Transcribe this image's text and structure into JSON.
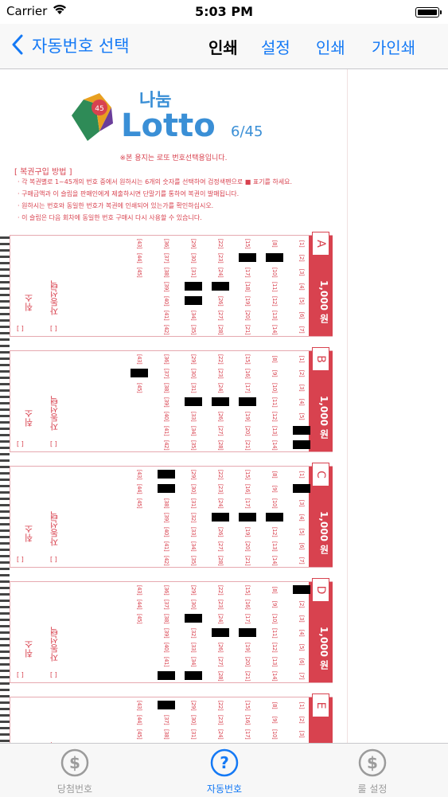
{
  "status_bar": {
    "carrier": "Carrier",
    "time": "5:03 PM"
  },
  "nav": {
    "back_label": "자동번호 선택",
    "title": "인쇄",
    "buttons": [
      "설정",
      "인쇄",
      "가인쇄"
    ]
  },
  "ticket": {
    "logo_brand": "나눔",
    "logo_lotto": "Lotto",
    "logo_game": "6/45",
    "logo_ball": "45",
    "notice": "※본 용지는 로또 번호선택용입니다.",
    "how_to_header": "[ 복권구입 방법 ]",
    "instructions": [
      "· 각 복권별로 1~45개의 번호 중에서 원하시는 6개의 숫자를 선택하여 검정색펜으로 ■ 표기를 하세요.",
      "· 구매금액과 이 슬립을 판매인에게 제출하시면 단말기를 통하여 복권이 발매됩니다.",
      "· 원하시는 번호와 동일한 번호가 복권에 인쇄되어 있는가를 확인하십시오.",
      "· 이 슬립은 다음 회차에 동일한 번호 구매시 다시 사용할 수 있습니다."
    ],
    "price_label": "1,000 원",
    "auto_label": "자동선택",
    "cancel_label": "취소",
    "bracket": "[   ]",
    "games": [
      {
        "letter": "A",
        "marked": [
          9,
          16,
          25,
          32,
          33
        ]
      },
      {
        "letter": "B",
        "marked": [
          6,
          7,
          18,
          25,
          32,
          44
        ]
      },
      {
        "letter": "C",
        "marked": [
          2,
          11,
          18,
          25,
          36,
          37
        ]
      },
      {
        "letter": "D",
        "marked": [
          1,
          18,
          25,
          31,
          35,
          42
        ]
      },
      {
        "letter": "E",
        "marked": [
          36
        ]
      }
    ]
  },
  "tabbar": {
    "items": [
      {
        "label": "당첨번호",
        "icon": "dollar-icon",
        "active": false
      },
      {
        "label": "자동번호",
        "icon": "question-icon",
        "active": true
      },
      {
        "label": "룰 설정",
        "icon": "dollar-icon",
        "active": false
      }
    ]
  },
  "colors": {
    "accent": "#1479f5",
    "ticket_red": "#d8424f",
    "inactive": "#9b9b9b"
  }
}
